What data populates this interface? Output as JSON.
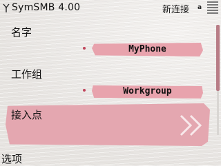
{
  "status_bar": {
    "app_title": "SymSMB 4.00",
    "connect_label": "新连接",
    "battery_indicator": "a"
  },
  "form": {
    "name": {
      "label": "名字",
      "value": "MyPhone"
    },
    "workgroup": {
      "label": "工作组",
      "value": "Workgroup"
    },
    "access_point": {
      "label": "接入点",
      "value": ""
    }
  },
  "softkeys": {
    "left": "选项"
  },
  "colors": {
    "field_fill": "#e8a3ad",
    "selection_fill": "#e4a7b0",
    "accent": "#c0455b"
  },
  "icons": [
    "signal-antenna-icon",
    "battery-icon",
    "watermark-icon"
  ]
}
